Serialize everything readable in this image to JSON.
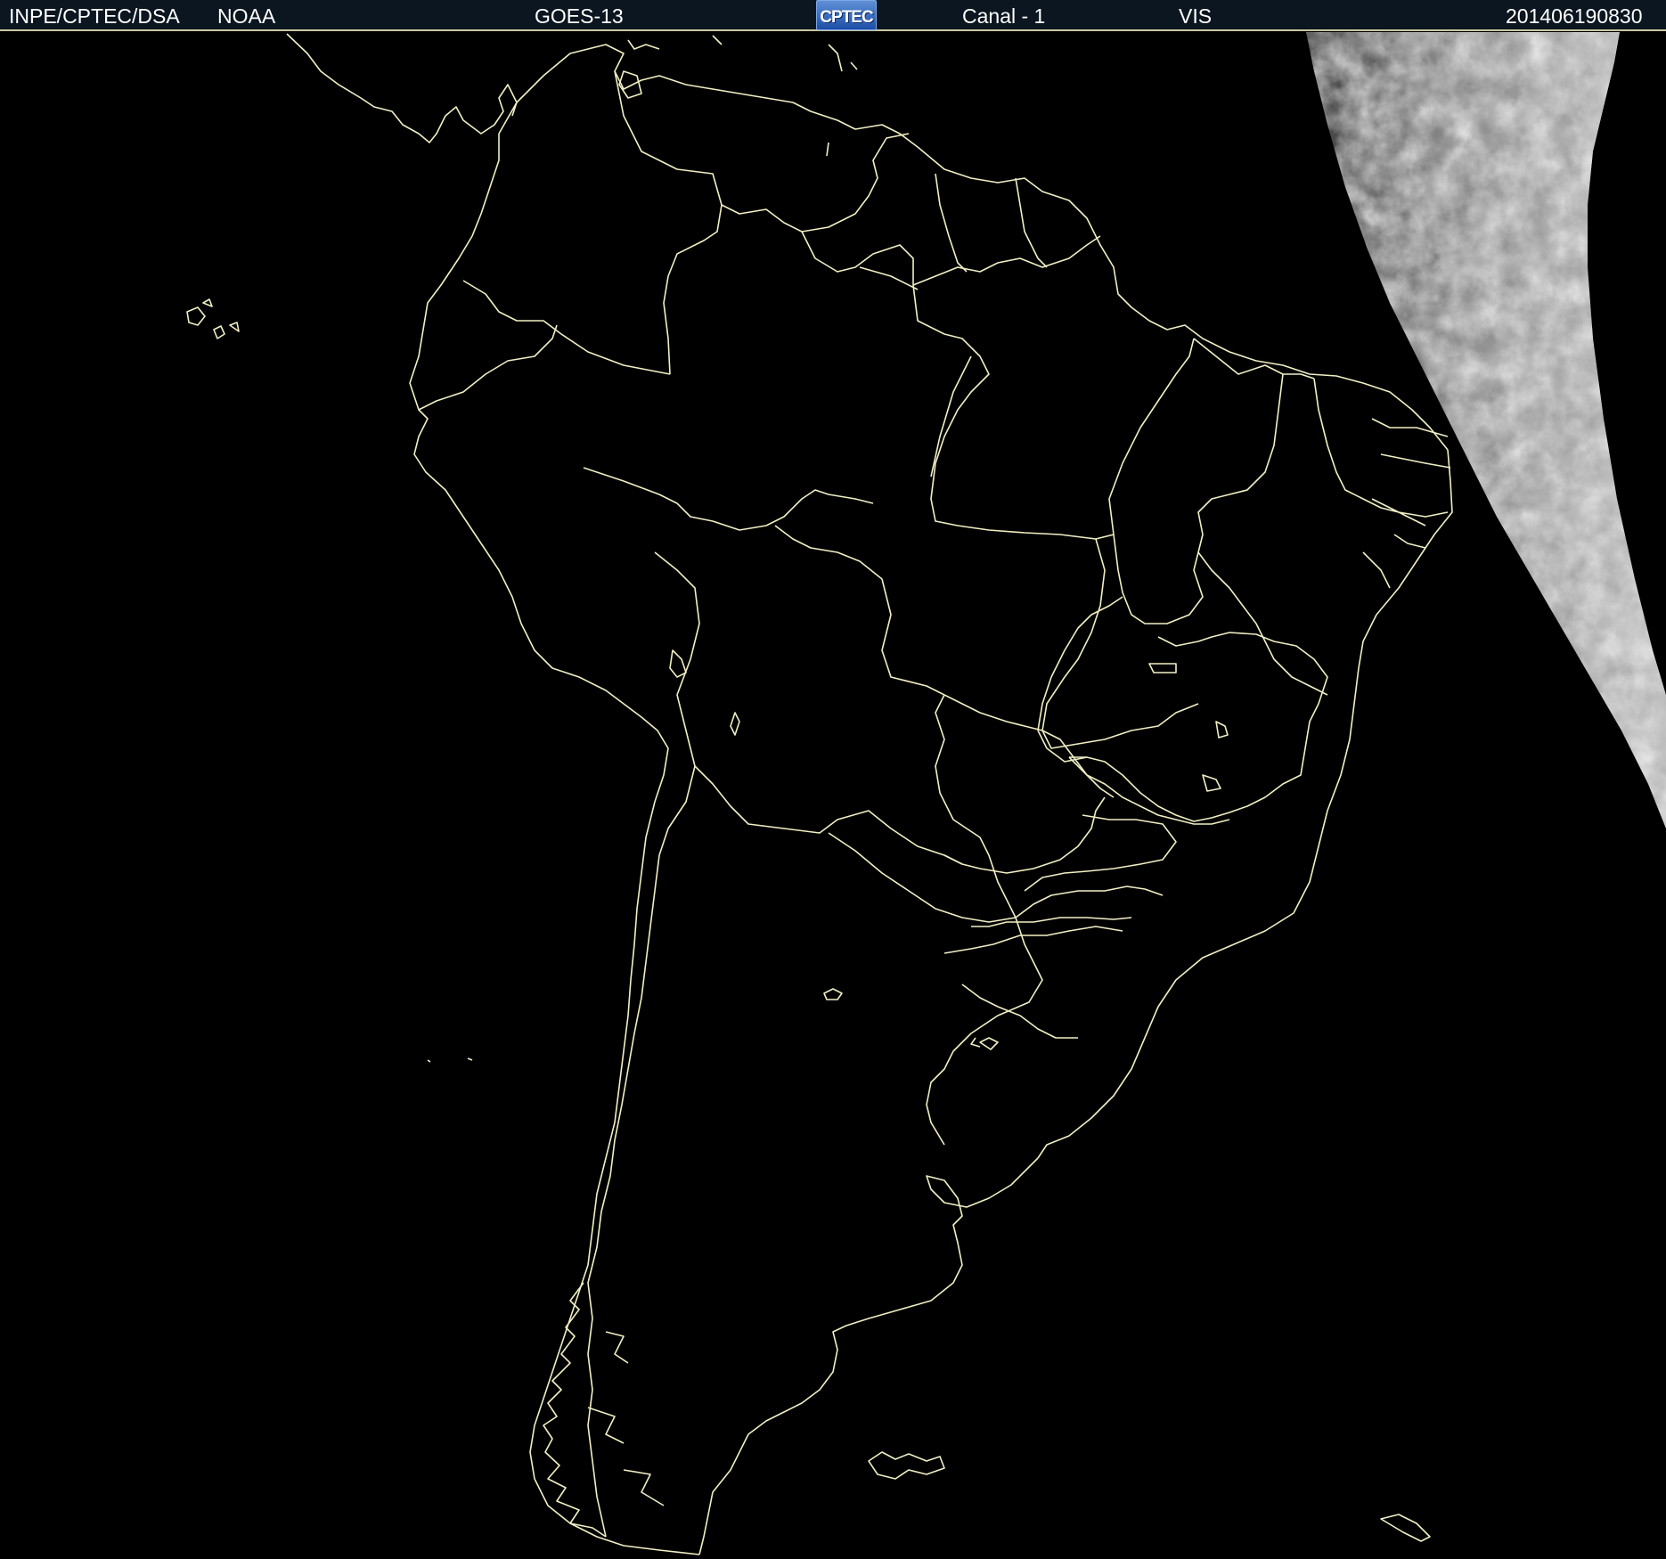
{
  "header": {
    "institution": "INPE/CPTEC/DSA",
    "agency": "NOAA",
    "satellite": "GOES-13",
    "logo_text": "CPTEC",
    "channel": "Canal - 1",
    "band": "VIS",
    "timestamp": "201406190830"
  },
  "map": {
    "projection_region": "South America",
    "background_color": "#000000",
    "border_color": "#f2efc4",
    "cloud_imagery": "visible-band clouds over eastern Atlantic terminator"
  }
}
